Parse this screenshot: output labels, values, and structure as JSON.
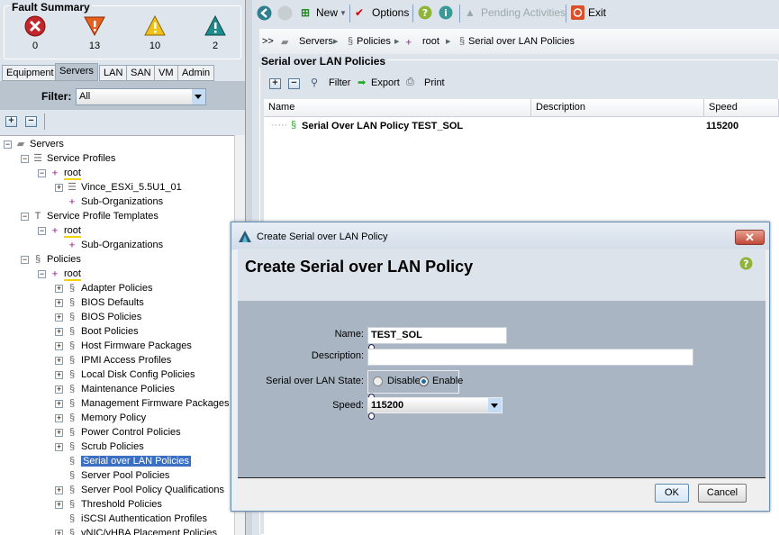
{
  "fault_summary": {
    "title": "Fault Summary",
    "items": [
      {
        "severity": "critical",
        "icon": "critical-x-icon",
        "count": "0",
        "color": "#c0262b"
      },
      {
        "severity": "major",
        "icon": "major-warning-icon",
        "count": "13",
        "color": "#e8601c"
      },
      {
        "severity": "minor",
        "icon": "minor-warning-icon",
        "count": "10",
        "color": "#f2c01a"
      },
      {
        "severity": "warning",
        "icon": "warning-icon",
        "count": "2",
        "color": "#1e8c8c"
      }
    ]
  },
  "nav_tabs": [
    "Equipment",
    "Servers",
    "LAN",
    "SAN",
    "VM",
    "Admin"
  ],
  "selected_tab": "Servers",
  "filter": {
    "label": "Filter:",
    "value": "All"
  },
  "tree": [
    {
      "label": "Servers",
      "depth": 0,
      "icon": "server-icon"
    },
    {
      "label": "Service Profiles",
      "depth": 1,
      "icon": "service-profile-icon"
    },
    {
      "label": "root",
      "depth": 2,
      "icon": "org-icon",
      "root": true
    },
    {
      "label": "Vince_ESXi_5.5U1_01",
      "depth": 3,
      "icon": "service-profile-icon"
    },
    {
      "label": "Sub-Organizations",
      "depth": 3,
      "icon": "org-icon",
      "leaf": true
    },
    {
      "label": "Service Profile Templates",
      "depth": 1,
      "icon": "template-icon"
    },
    {
      "label": "root",
      "depth": 2,
      "icon": "org-icon",
      "root": true
    },
    {
      "label": "Sub-Organizations",
      "depth": 3,
      "icon": "org-icon",
      "leaf": true
    },
    {
      "label": "Policies",
      "depth": 1,
      "icon": "policy-icon"
    },
    {
      "label": "root",
      "depth": 2,
      "icon": "org-icon",
      "root": true
    },
    {
      "label": "Adapter Policies",
      "depth": 3,
      "icon": "policy-icon"
    },
    {
      "label": "BIOS Defaults",
      "depth": 3,
      "icon": "policy-icon"
    },
    {
      "label": "BIOS Policies",
      "depth": 3,
      "icon": "policy-icon"
    },
    {
      "label": "Boot Policies",
      "depth": 3,
      "icon": "policy-icon"
    },
    {
      "label": "Host Firmware Packages",
      "depth": 3,
      "icon": "policy-icon"
    },
    {
      "label": "IPMI Access Profiles",
      "depth": 3,
      "icon": "policy-icon"
    },
    {
      "label": "Local Disk Config Policies",
      "depth": 3,
      "icon": "policy-icon"
    },
    {
      "label": "Maintenance Policies",
      "depth": 3,
      "icon": "policy-icon"
    },
    {
      "label": "Management Firmware Packages",
      "depth": 3,
      "icon": "policy-icon"
    },
    {
      "label": "Memory Policy",
      "depth": 3,
      "icon": "policy-icon"
    },
    {
      "label": "Power Control Policies",
      "depth": 3,
      "icon": "policy-icon"
    },
    {
      "label": "Scrub Policies",
      "depth": 3,
      "icon": "policy-icon"
    },
    {
      "label": "Serial over LAN Policies",
      "depth": 3,
      "icon": "policy-icon",
      "selected": true,
      "leaf": true
    },
    {
      "label": "Server Pool Policies",
      "depth": 3,
      "icon": "policy-icon",
      "leaf": true
    },
    {
      "label": "Server Pool Policy Qualifications",
      "depth": 3,
      "icon": "policy-icon"
    },
    {
      "label": "Threshold Policies",
      "depth": 3,
      "icon": "policy-icon"
    },
    {
      "label": "iSCSI Authentication Profiles",
      "depth": 3,
      "icon": "policy-icon",
      "leaf": true
    },
    {
      "label": "vNIC/vHBA Placement Policies",
      "depth": 3,
      "icon": "policy-icon"
    }
  ],
  "toolbar": {
    "new": "New",
    "options": "Options",
    "pending": "Pending Activities",
    "exit": "Exit"
  },
  "breadcrumb": {
    "prefix": ">>",
    "items": [
      "Servers",
      "Policies",
      "root",
      "Serial over LAN Policies"
    ]
  },
  "panel": {
    "title": "Serial over LAN Policies",
    "filter": "Filter",
    "export": "Export",
    "print": "Print",
    "columns": [
      "Name",
      "Description",
      "Speed"
    ],
    "rows": [
      {
        "name": "Serial Over LAN Policy TEST_SOL",
        "description": "",
        "speed": "115200"
      }
    ]
  },
  "dialog": {
    "window_title": "Create Serial over LAN Policy",
    "heading": "Create Serial over LAN Policy",
    "name_label": "Name:",
    "name_value": "TEST_SOL",
    "description_label": "Description:",
    "description_value": "",
    "state_label": "Serial over LAN State:",
    "state_options": [
      "Disable",
      "Enable"
    ],
    "state_selected": "Enable",
    "speed_label": "Speed:",
    "speed_value": "115200",
    "ok": "OK",
    "cancel": "Cancel"
  }
}
